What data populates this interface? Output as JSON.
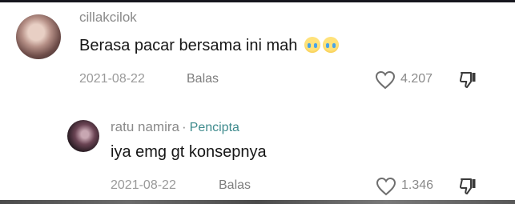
{
  "comments": [
    {
      "username": "cillakcilok",
      "text": "Berasa pacar bersama ini mah",
      "emojis": [
        "crying-face",
        "crying-face"
      ],
      "date": "2021-08-22",
      "reply_label": "Balas",
      "likes": "4.207"
    },
    {
      "username": "ratu namira",
      "separator": "·",
      "badge": "Pencipta",
      "text": "iya emg gt konsepnya",
      "date": "2021-08-22",
      "reply_label": "Balas",
      "likes": "1.346"
    }
  ],
  "colors": {
    "creator_badge": "#3f8b8d",
    "text": "#161616",
    "muted": "#8a8a8a"
  }
}
